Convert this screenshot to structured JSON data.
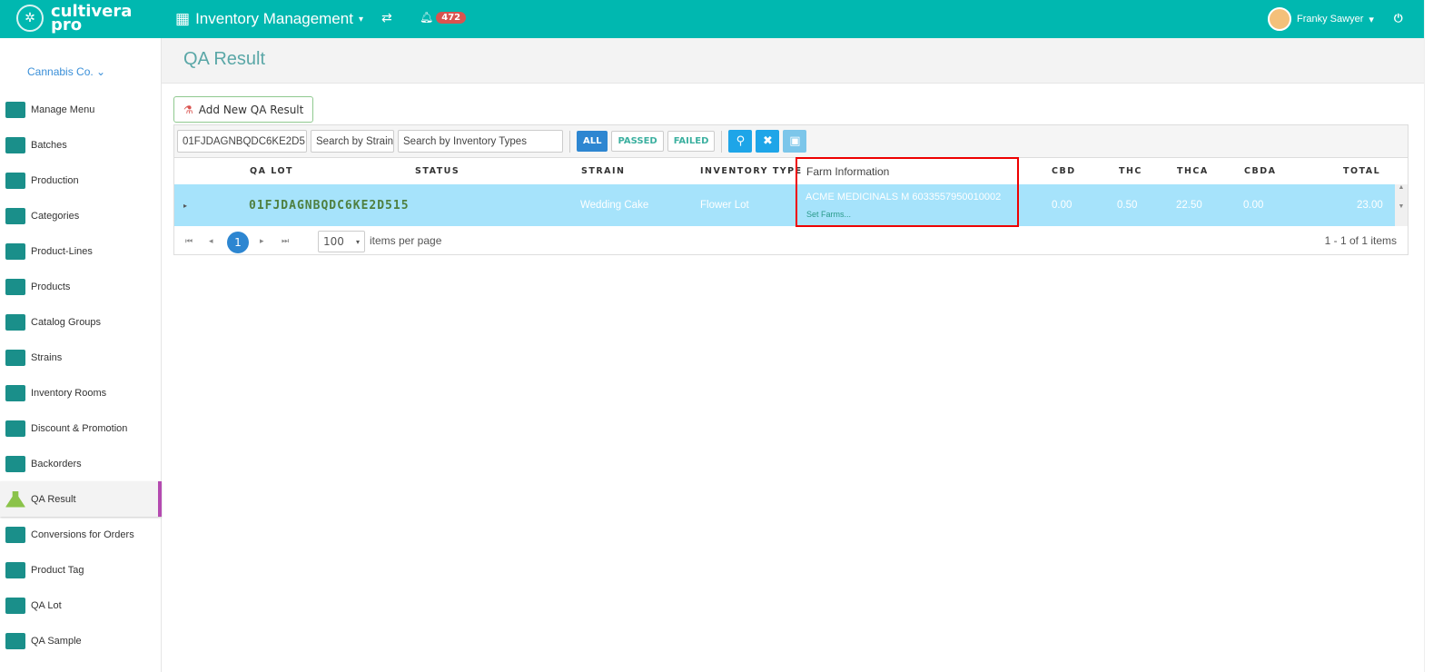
{
  "topbar": {
    "logo_line1": "cultivera",
    "logo_line2": "pro",
    "module": "Inventory Management",
    "notifications": "472",
    "user": "Franky Sawyer"
  },
  "sidebar": {
    "company": "Cannabis Co. ⌄",
    "items": [
      "Manage Menu",
      "Batches",
      "Production",
      "Categories",
      "Product-Lines",
      "Products",
      "Catalog Groups",
      "Strains",
      "Inventory Rooms",
      "Discount & Promotion",
      "Backorders",
      "QA Result",
      "Conversions for Orders",
      "Product Tag",
      "QA Lot",
      "QA Sample"
    ],
    "active": "QA Result"
  },
  "page": {
    "title": "QA Result",
    "add_button": "Add New QA Result"
  },
  "filters": {
    "lot_value": "01FJDAGNBQDC6KE2D5",
    "strain_placeholder": "Search by Strain",
    "type_placeholder": "Search by Inventory Types",
    "all": "ALL",
    "passed": "PASSED",
    "failed": "FAILED"
  },
  "table": {
    "headers": {
      "lot": "QA LOT",
      "status": "STATUS",
      "strain": "STRAIN",
      "type": "INVENTORY TYPE",
      "farm": "Farm Information",
      "cbd": "CBD",
      "thc": "THC",
      "thca": "THCA",
      "cbda": "CBDA",
      "total": "TOTAL"
    },
    "rows": [
      {
        "lot": "01FJDAGNBQDC6KE2D515",
        "status": "",
        "strain": "Wedding Cake",
        "type": "Flower Lot",
        "farm": "ACME MEDICINALS M 6033557950010002",
        "set_farms": "Set Farms...",
        "cbd": "0.00",
        "thc": "0.50",
        "thca": "22.50",
        "cbda": "0.00",
        "total": "23.00"
      }
    ]
  },
  "pager": {
    "page": "1",
    "page_size": "100",
    "items_per_page": "items per page",
    "summary": "1 - 1 of 1 items"
  }
}
